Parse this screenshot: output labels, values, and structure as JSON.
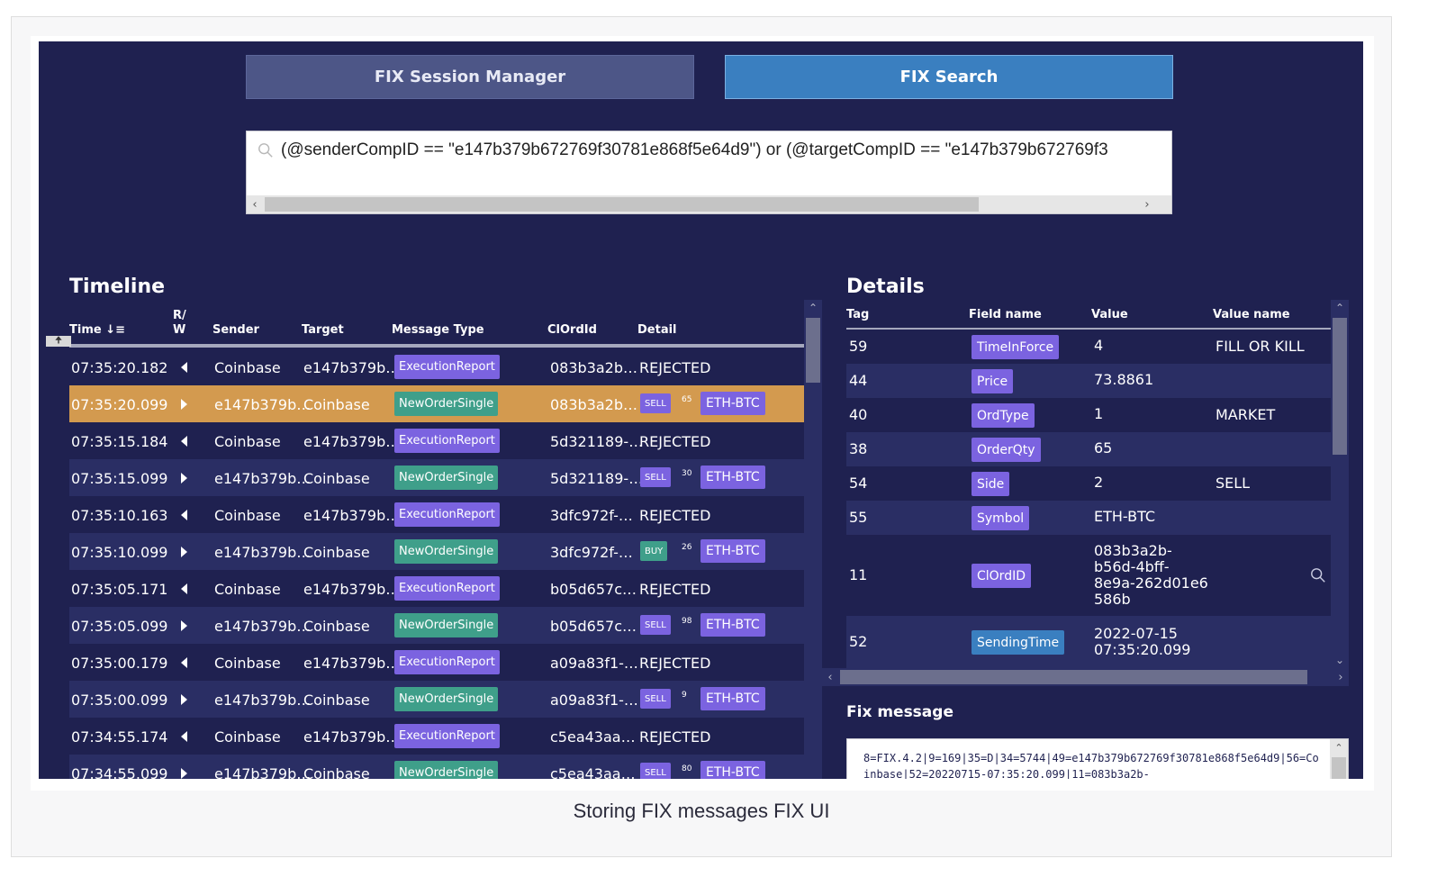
{
  "tabs": {
    "manager": "FIX Session Manager",
    "search": "FIX Search"
  },
  "search": {
    "query": "(@senderCompID == \"e147b379b672769f30781e868f5e64d9\") or (@targetCompID == \"e147b379b672769f3"
  },
  "timeline": {
    "title": "Timeline",
    "headers": {
      "time": "Time",
      "rw": "R/\nW",
      "sender": "Sender",
      "target": "Target",
      "message_type": "Message Type",
      "clordid": "ClOrdId",
      "detail": "Detail"
    },
    "rows": [
      {
        "time": "07:35:20.182",
        "dir": "left",
        "sender": "Coinbase",
        "target": "e147b379b…",
        "type": "ExecutionReport",
        "clordid": "083b3a2b…",
        "detail": "REJECTED"
      },
      {
        "time": "07:35:20.099",
        "dir": "right",
        "sender": "e147b379b…",
        "target": "Coinbase",
        "type": "NewOrderSingle",
        "clordid": "083b3a2b…",
        "side": "SELL",
        "qty": "65",
        "symbol": "ETH-BTC"
      },
      {
        "time": "07:35:15.184",
        "dir": "left",
        "sender": "Coinbase",
        "target": "e147b379b…",
        "type": "ExecutionReport",
        "clordid": "5d321189-…",
        "detail": "REJECTED"
      },
      {
        "time": "07:35:15.099",
        "dir": "right",
        "sender": "e147b379b…",
        "target": "Coinbase",
        "type": "NewOrderSingle",
        "clordid": "5d321189-…",
        "side": "SELL",
        "qty": "30",
        "symbol": "ETH-BTC"
      },
      {
        "time": "07:35:10.163",
        "dir": "left",
        "sender": "Coinbase",
        "target": "e147b379b…",
        "type": "ExecutionReport",
        "clordid": "3dfc972f-…",
        "detail": "REJECTED"
      },
      {
        "time": "07:35:10.099",
        "dir": "right",
        "sender": "e147b379b…",
        "target": "Coinbase",
        "type": "NewOrderSingle",
        "clordid": "3dfc972f-…",
        "side": "BUY",
        "qty": "26",
        "symbol": "ETH-BTC"
      },
      {
        "time": "07:35:05.171",
        "dir": "left",
        "sender": "Coinbase",
        "target": "e147b379b…",
        "type": "ExecutionReport",
        "clordid": "b05d657c…",
        "detail": "REJECTED"
      },
      {
        "time": "07:35:05.099",
        "dir": "right",
        "sender": "e147b379b…",
        "target": "Coinbase",
        "type": "NewOrderSingle",
        "clordid": "b05d657c…",
        "side": "SELL",
        "qty": "98",
        "symbol": "ETH-BTC"
      },
      {
        "time": "07:35:00.179",
        "dir": "left",
        "sender": "Coinbase",
        "target": "e147b379b…",
        "type": "ExecutionReport",
        "clordid": "a09a83f1-…",
        "detail": "REJECTED"
      },
      {
        "time": "07:35:00.099",
        "dir": "right",
        "sender": "e147b379b…",
        "target": "Coinbase",
        "type": "NewOrderSingle",
        "clordid": "a09a83f1-…",
        "side": "SELL",
        "qty": "9",
        "symbol": "ETH-BTC"
      },
      {
        "time": "07:34:55.174",
        "dir": "left",
        "sender": "Coinbase",
        "target": "e147b379b…",
        "type": "ExecutionReport",
        "clordid": "c5ea43aa…",
        "detail": "REJECTED"
      },
      {
        "time": "07:34:55.099",
        "dir": "right",
        "sender": "e147b379b…",
        "target": "Coinbase",
        "type": "NewOrderSingle",
        "clordid": "c5ea43aa…",
        "side": "SELL",
        "qty": "80",
        "symbol": "ETH-BTC"
      }
    ]
  },
  "details": {
    "title": "Details",
    "headers": {
      "tag": "Tag",
      "field": "Field name",
      "value": "Value",
      "value_name": "Value name"
    },
    "rows": [
      {
        "tag": "59",
        "field": "TimeInForce",
        "value": "4",
        "value_name": "FILL OR KILL"
      },
      {
        "tag": "44",
        "field": "Price",
        "value": "73.8861",
        "value_name": ""
      },
      {
        "tag": "40",
        "field": "OrdType",
        "value": "1",
        "value_name": "MARKET"
      },
      {
        "tag": "38",
        "field": "OrderQty",
        "value": "65",
        "value_name": ""
      },
      {
        "tag": "54",
        "field": "Side",
        "value": "2",
        "value_name": "SELL"
      },
      {
        "tag": "55",
        "field": "Symbol",
        "value": "ETH-BTC",
        "value_name": ""
      },
      {
        "tag": "11",
        "field": "ClOrdID",
        "value": "083b3a2b-\nb56d-4bff-\n8e9a-262d01e6\n586b",
        "value_name": ""
      },
      {
        "tag": "52",
        "field": "SendingTime",
        "value": "2022-07-15\n07:35:20.099",
        "value_name": ""
      }
    ]
  },
  "fix_message": {
    "title": "Fix message",
    "text": "8=FIX.4.2|9=169|35=D|34=5744|49=e147b379b672769f30781e868f5e64d9|56=Coinbase|52=20220715-07:35:20.099|11=083b3a2b-"
  },
  "caption": "Storing FIX messages FIX UI"
}
